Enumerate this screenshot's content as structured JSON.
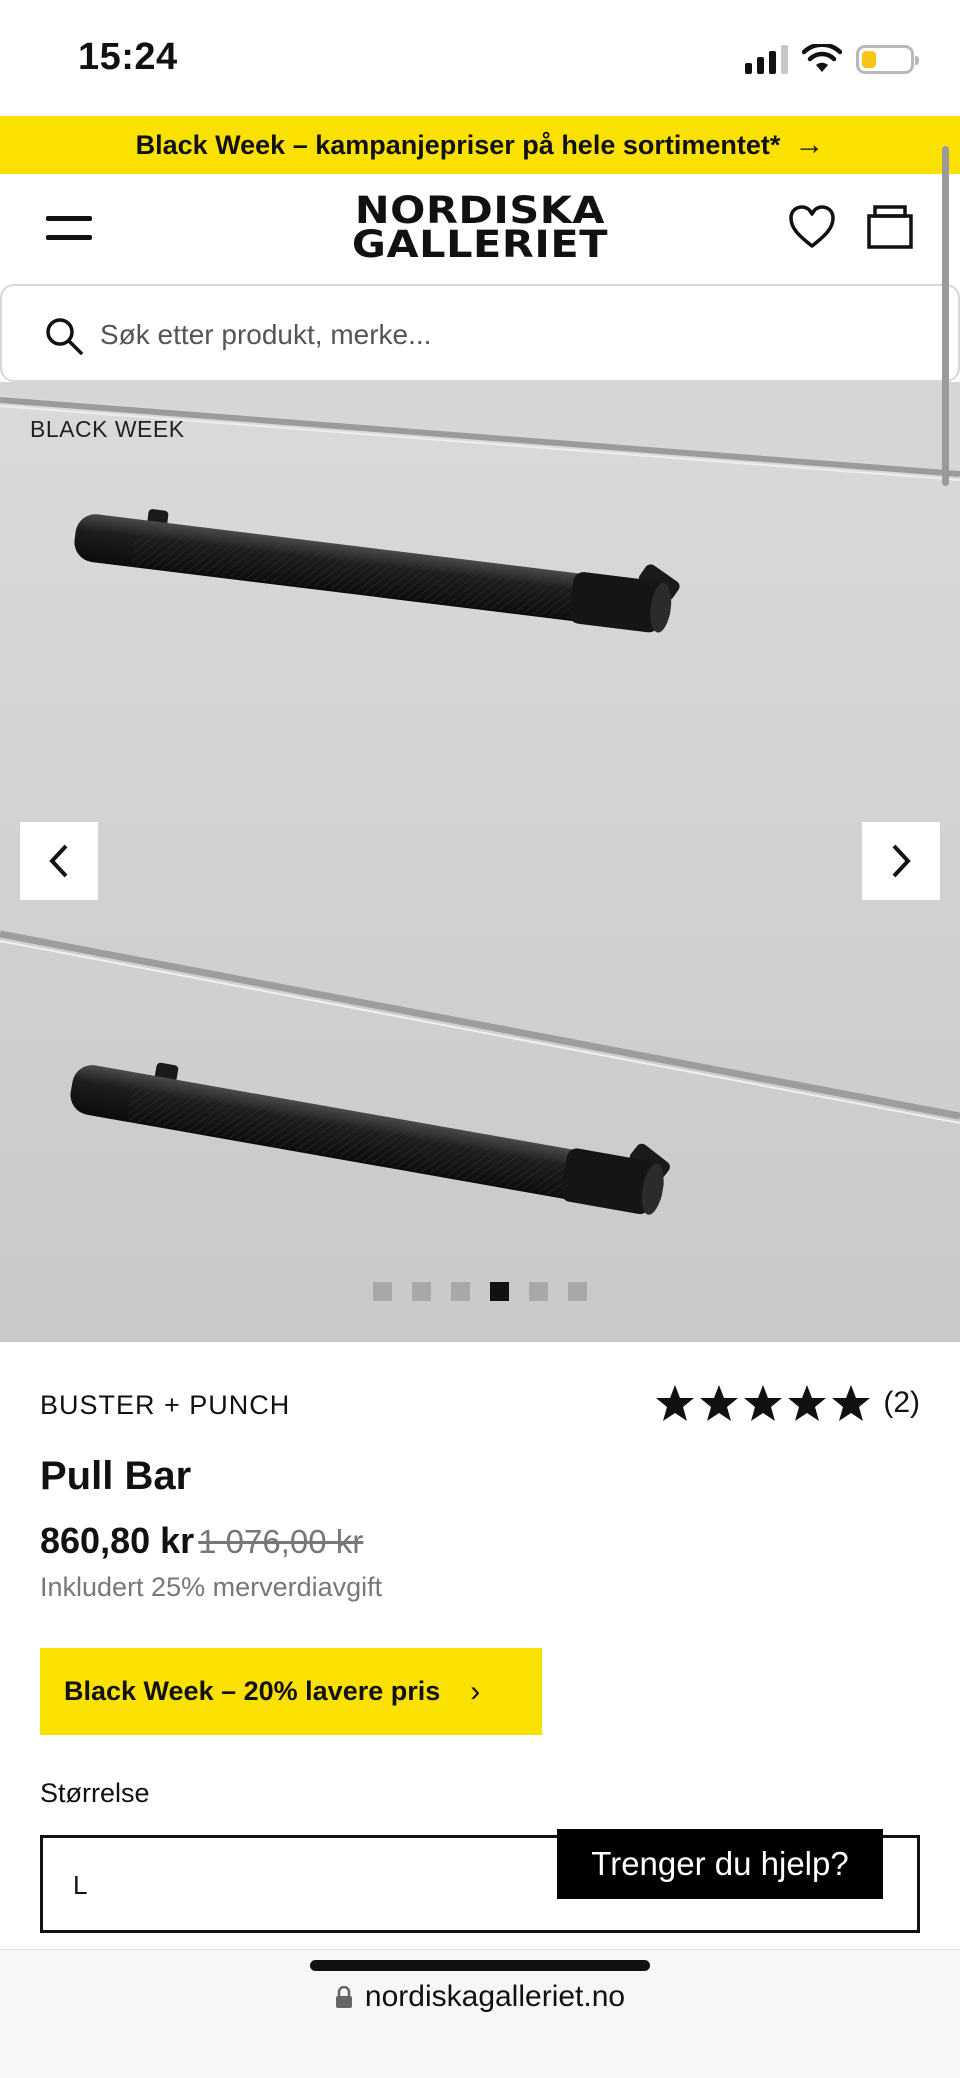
{
  "status_bar": {
    "time": "15:24",
    "battery_level": 0.3,
    "battery_color": "#f5c518",
    "icons": [
      "signal-icon",
      "wifi-icon",
      "battery-icon"
    ]
  },
  "promo_banner": {
    "text": "Black Week – kampanjepriser på hele sortimentet*",
    "arrow": "→",
    "background": "#fae100"
  },
  "header": {
    "logo_line1": "NORDISKA",
    "logo_line2": "GALLERIET",
    "icons": [
      "menu-icon",
      "heart-icon",
      "bag-icon"
    ]
  },
  "search": {
    "placeholder": "Søk etter produkt, merke..."
  },
  "gallery": {
    "badge": "BLACK WEEK",
    "image_count": 6,
    "active_index": 3,
    "prev_icon": "chevron-left-icon",
    "next_icon": "chevron-right-icon"
  },
  "product": {
    "brand": "BUSTER + PUNCH",
    "rating_stars": 5,
    "review_count": "(2)",
    "title": "Pull Bar",
    "price": "860,80 kr",
    "old_price": "1 076,00 kr",
    "vat_note": "Inkludert 25% merverdiavgift",
    "cta_label": "Black Week – 20% lavere pris",
    "cta_chevron": "›",
    "size_label": "Størrelse",
    "size_value": "L"
  },
  "help_button": {
    "label": "Trenger du hjelp?"
  },
  "browser": {
    "url": "nordiskagalleriet.no"
  },
  "colors": {
    "accent_yellow": "#fae100",
    "text": "#111111",
    "muted": "#777777"
  }
}
